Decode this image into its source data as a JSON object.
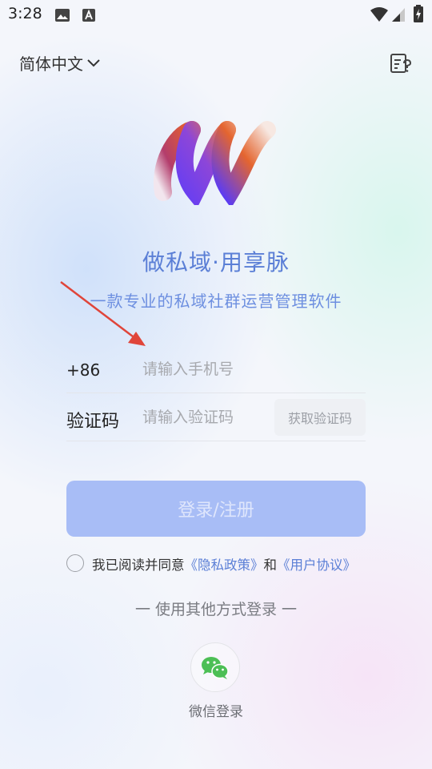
{
  "status_bar": {
    "time": "3:28",
    "icons": [
      "image-icon",
      "a-icon",
      "wifi-icon",
      "signal-icon",
      "battery-charging-icon"
    ]
  },
  "header": {
    "language": "简体中文",
    "help_icon": "help-doc-icon"
  },
  "brand": {
    "slogan": "做私域·用享脉",
    "subtitle": "一款专业的私域社群运营管理软件"
  },
  "login_form": {
    "country_code": "+86",
    "phone_placeholder": "请输入手机号",
    "code_label": "验证码",
    "code_placeholder": "请输入验证码",
    "get_code_label": "获取验证码",
    "submit_label": "登录/注册"
  },
  "agreement": {
    "prefix": "我已阅读并同意",
    "privacy_link": "《隐私政策》",
    "connector": "和",
    "terms_link": "《用户协议》",
    "checked": false
  },
  "other_login": {
    "divider": "一 使用其他方式登录 一",
    "wechat_label": "微信登录",
    "wechat_icon": "wechat-icon"
  },
  "colors": {
    "accent": "#5b7fd6",
    "button_disabled": "#a8bdf6",
    "annotation_arrow": "#e0453a"
  }
}
